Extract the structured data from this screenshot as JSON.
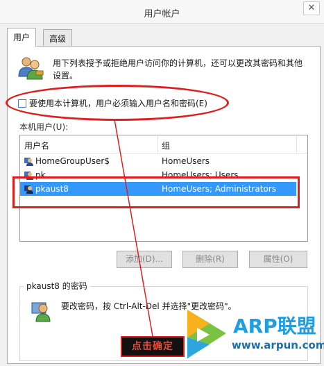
{
  "window": {
    "title": "用户帐户",
    "close_label": "✕"
  },
  "tabs": [
    {
      "label": "用户",
      "active": true
    },
    {
      "label": "高级",
      "active": false
    }
  ],
  "intro": {
    "text": "用下列表授予或拒绝用户访问你的计算机，还可以更改其密码和其他设置。"
  },
  "require_login": {
    "label": "要使用本计算机，用户必须输入用户名和密码(E)",
    "checked": false
  },
  "local_users": {
    "label": "本机用户(U):",
    "columns": [
      "用户名",
      "组"
    ],
    "rows": [
      {
        "name": "HomeGroupUser$",
        "group": "HomeUsers",
        "selected": false
      },
      {
        "name": "pk",
        "group": "HomeUsers; Users",
        "selected": false
      },
      {
        "name": "pkaust8",
        "group": "HomeUsers; Administrators",
        "selected": true
      }
    ]
  },
  "buttons": {
    "add": "添加(D)...",
    "delete": "删除(R)",
    "properties": "属性(O)"
  },
  "password": {
    "title": "pkaust8 的密码",
    "text": "要改密码，按 Ctrl-Alt-Del 并选择\"更改密码\"。"
  },
  "annotation": {
    "label": "点击确定",
    "color": "#e01e1e"
  },
  "watermark": {
    "brand": "ARP联盟",
    "url": "www.arpun.com"
  },
  "colors": {
    "selection": "#3399ff",
    "annotation": "#e01e1e",
    "brand": "#1f9ee0"
  }
}
